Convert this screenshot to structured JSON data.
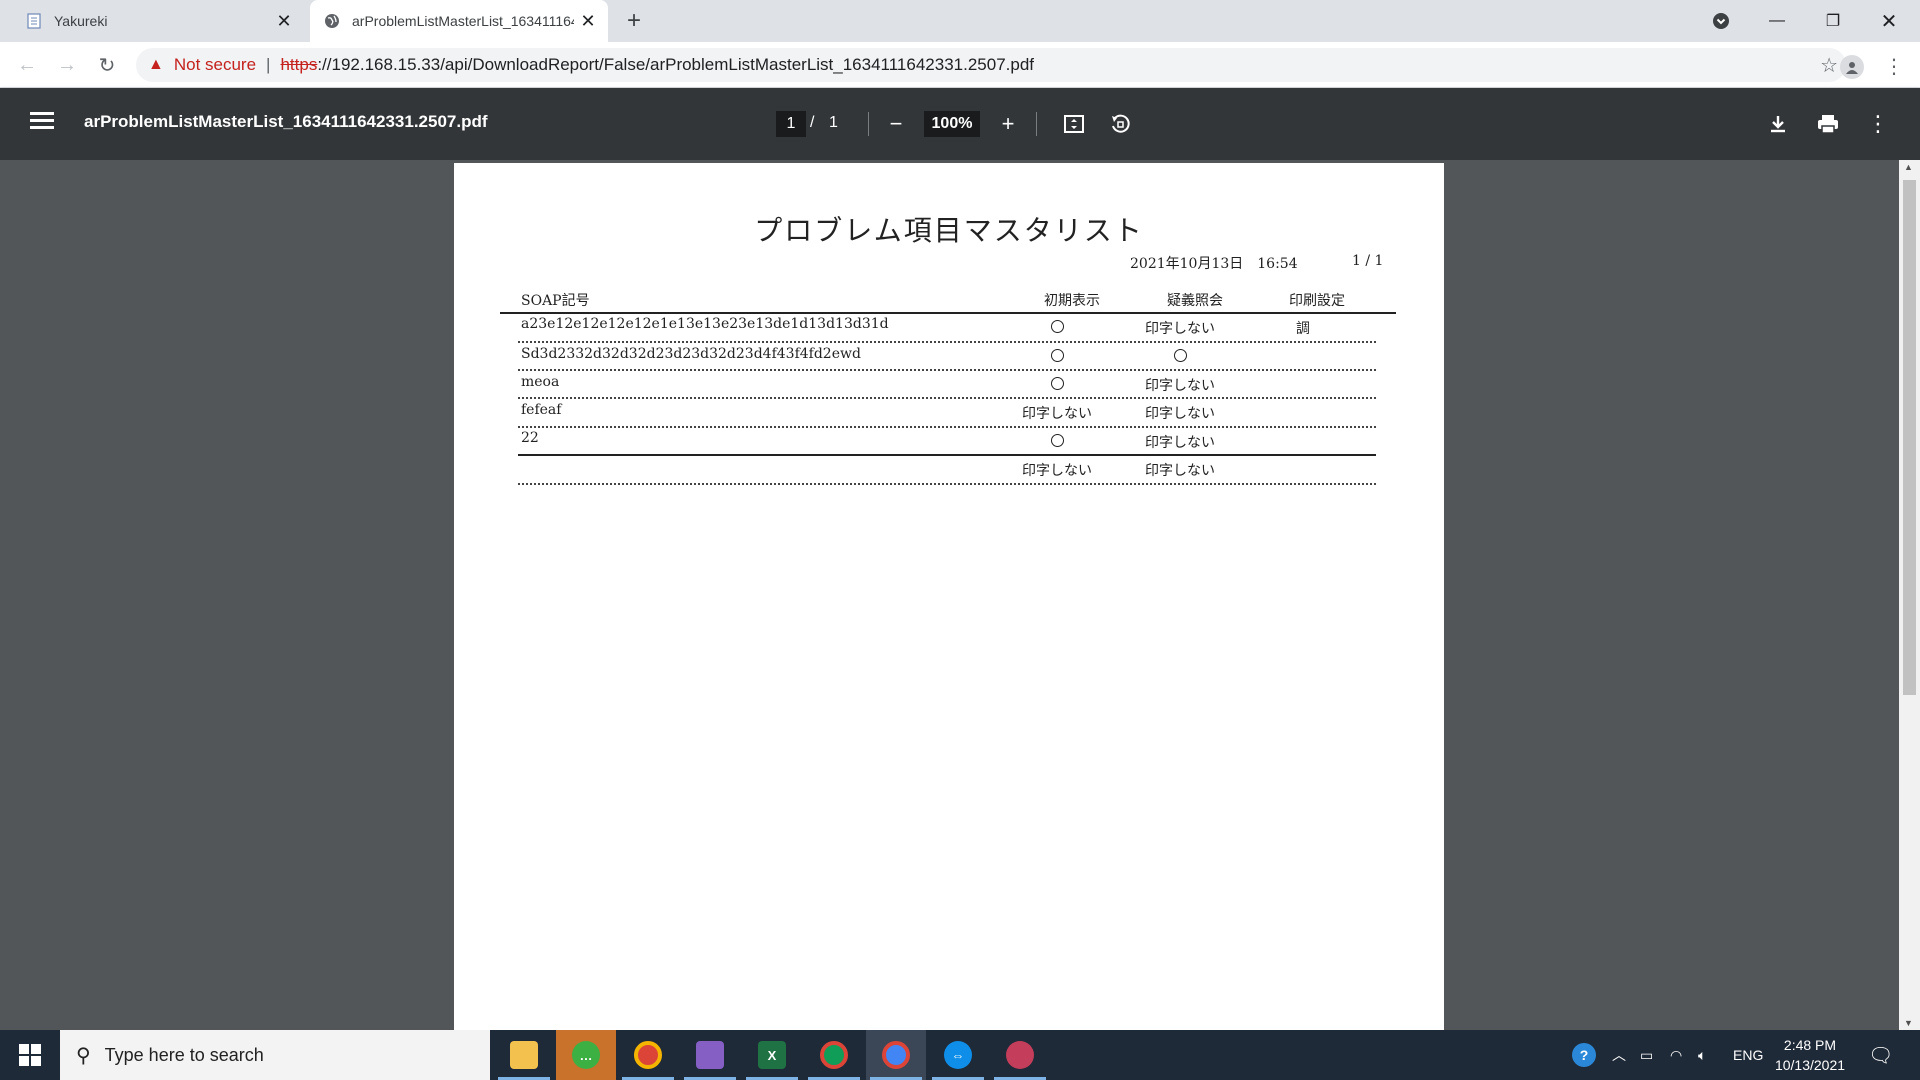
{
  "browser": {
    "tabs": [
      {
        "title": "Yakureki",
        "active": false
      },
      {
        "title": "arProblemListMasterList_1634111642331.2507.pdf",
        "active": true
      }
    ],
    "address": {
      "security": "Not secure",
      "protocol": "https",
      "rest": "://192.168.15.33/api/DownloadReport/False/arProblemListMasterList_1634111642331.2507.pdf"
    }
  },
  "pdf_viewer": {
    "filename": "arProblemListMasterList_1634111642331.2507.pdf",
    "current_page": "1",
    "separator": "/",
    "total_pages": "1",
    "zoom": "100%"
  },
  "report": {
    "title": "プロブレム項目マスタリスト",
    "date": "2021年10月13日　16:54",
    "page_number": "1 / 1",
    "columns": [
      "SOAP記号",
      "初期表示",
      "疑義照会",
      "印刷設定"
    ],
    "rows": [
      {
        "soap": "a23e12e12e12e12e1e13e13e23e13de1d13d13d31d",
        "initial": "○",
        "inquiry": "印字しない",
        "print": "調"
      },
      {
        "soap": "Sd3d2332d32d32d23d23d32d23d4f43f4fd2ewd",
        "initial": "○",
        "inquiry": "○",
        "print": ""
      },
      {
        "soap": "meoa",
        "initial": "○",
        "inquiry": "印字しない",
        "print": ""
      },
      {
        "soap": "fefeaf",
        "initial": "印字しない",
        "inquiry": "印字しない",
        "print": ""
      },
      {
        "soap": "22",
        "initial": "○",
        "inquiry": "印字しない",
        "print": ""
      }
    ],
    "footer_row": {
      "initial": "印字しない",
      "inquiry": "印字しない"
    }
  },
  "taskbar": {
    "search_placeholder": "Type here to search",
    "language": "ENG",
    "time": "2:48 PM",
    "date": "10/13/2021"
  },
  "colors": {
    "tab_bar": "#dee1e6",
    "pdf_toolbar": "#323639",
    "viewer_bg": "#525659",
    "not_secure": "#c5221f",
    "taskbar": "#1f2a38"
  }
}
